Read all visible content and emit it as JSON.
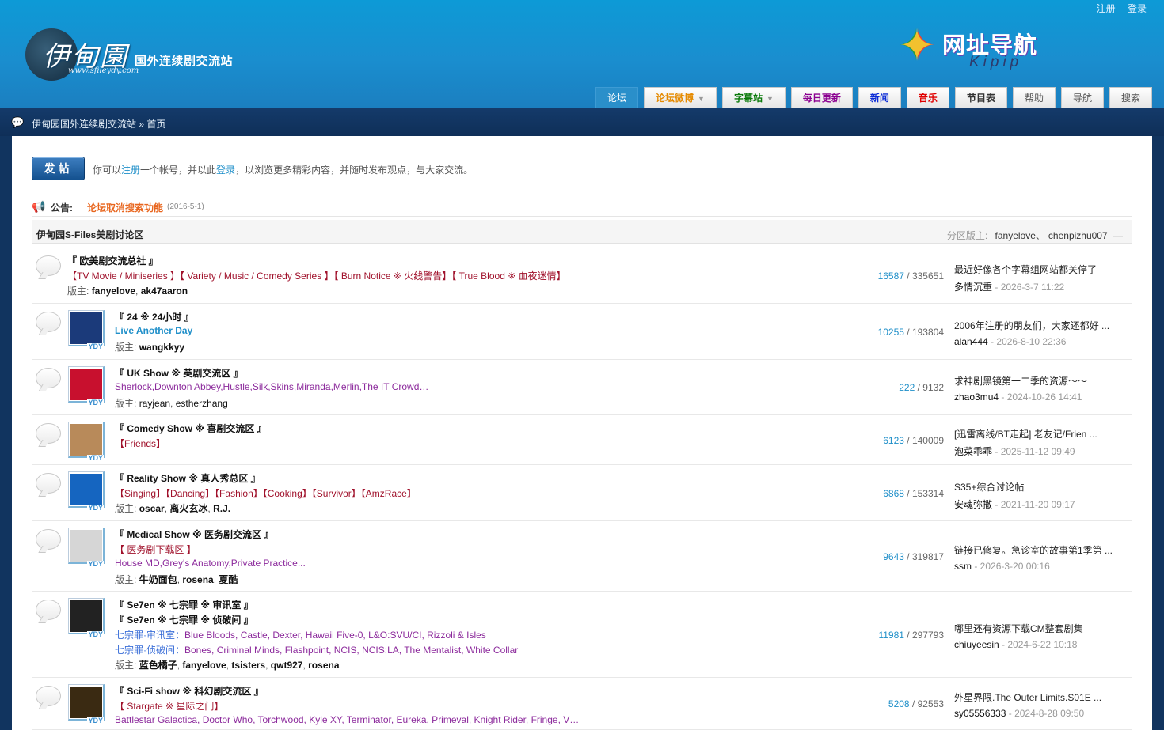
{
  "header": {
    "logo_cn": "伊甸園",
    "logo_url": "www.sfileydy.com",
    "logo_subtitle": "国外连续剧交流站",
    "top_links": [
      {
        "label": "注册"
      },
      {
        "label": "登录"
      }
    ],
    "kipip_cn": "网址导航",
    "kipip_en": "Kipip",
    "nav": [
      {
        "label": "论坛",
        "active": true,
        "color": "#ffffff",
        "bold": false,
        "dropdown": false
      },
      {
        "label": "论坛微博",
        "active": false,
        "color": "#e58a00",
        "bold": true,
        "dropdown": true
      },
      {
        "label": "字幕站",
        "active": false,
        "color": "#0a7a0a",
        "bold": true,
        "dropdown": true
      },
      {
        "label": "每日更新",
        "active": false,
        "color": "#8b0090",
        "bold": true,
        "dropdown": false
      },
      {
        "label": "新闻",
        "active": false,
        "color": "#0b2bd6",
        "bold": true,
        "dropdown": false
      },
      {
        "label": "音乐",
        "active": false,
        "color": "#e00000",
        "bold": true,
        "dropdown": false
      },
      {
        "label": "节目表",
        "active": false,
        "color": "#333333",
        "bold": true,
        "dropdown": false
      },
      {
        "label": "帮助",
        "active": false,
        "color": "#555555",
        "bold": false,
        "dropdown": false
      },
      {
        "label": "导航",
        "active": false,
        "color": "#555555",
        "bold": false,
        "dropdown": false
      },
      {
        "label": "搜索",
        "active": false,
        "color": "#555555",
        "bold": false,
        "dropdown": false
      }
    ]
  },
  "breadcrumb": {
    "site": "伊甸园国外连续剧交流站",
    "sep": "»",
    "current": "首页"
  },
  "post_button": "发帖",
  "welcome": {
    "pre": "你可以",
    "register": "注册",
    "mid": "一个帐号，并以此",
    "login": "登录",
    "post": "，以浏览更多精彩内容，并随时发布观点，与大家交流。"
  },
  "notice": {
    "label": "公告:",
    "text": "论坛取消搜索功能",
    "date": "(2016-5-1)"
  },
  "category": {
    "title": "伊甸园S-Files美剧讨论区",
    "mods_label": "分区版主:",
    "mods": [
      "fanyelove",
      "chenpizhu007"
    ],
    "mods_sep": "、",
    "dash": "—"
  },
  "forums": [
    {
      "name": "『 欧美剧交流总社 』",
      "lines": [
        [
          {
            "t": "【TV Movie / Miniseries 】【 Variety / Music / Comedy Series 】【 Burn Notice ※ 火线警告】【 True Blood ※ 血夜迷情】",
            "c": "r"
          }
        ]
      ],
      "mods_label": "版主:",
      "mods": [
        {
          "n": "fanyelove",
          "b": true
        },
        {
          "n": "ak47aaron",
          "b": true
        }
      ],
      "threads": "16587",
      "posts": "335651",
      "last_title": "最近好像各个字幕组网站都关停了",
      "last_author": "多情沉重",
      "last_date": "2026-3-7 11:22",
      "thumb": ""
    },
    {
      "name": "『 24 ※ 24小时 』",
      "lines": [
        [
          {
            "t": "Live Another Day",
            "c": "b"
          }
        ]
      ],
      "mods_label": "版主:",
      "mods": [
        {
          "n": "wangkkyy",
          "b": true
        }
      ],
      "threads": "10255",
      "posts": "193804",
      "last_title": "2006年注册的朋友们，大家还都好 ...",
      "last_author": "alan444",
      "last_date": "2026-8-10 22:36",
      "thumb": "24"
    },
    {
      "name": "『 UK Show ※ 英剧交流区 』",
      "lines": [
        [
          {
            "t": "Sherlock,Downton Abbey,Hustle,Silk,Skins,Miranda,Merlin,The IT Crowd…",
            "c": "p"
          }
        ]
      ],
      "mods_label": "版主:",
      "mods": [
        {
          "n": "rayjean",
          "b": false
        },
        {
          "n": "estherzhang",
          "b": false
        }
      ],
      "threads": "222",
      "posts": "9132",
      "last_title": "求神剧黑镜第一二季的资源～～",
      "last_author": "zhao3mu4",
      "last_date": "2024-10-26 14:41",
      "thumb": "UK"
    },
    {
      "name": "『 Comedy Show ※ 喜剧交流区 』",
      "lines": [
        [
          {
            "t": "【Friends】",
            "c": "r"
          }
        ]
      ],
      "mods_label": "",
      "mods": [],
      "threads": "6123",
      "posts": "140009",
      "last_title": "[迅雷离线/BT走起] 老友记/Frien ...",
      "last_author": "泡菜乖乖",
      "last_date": "2025-11-12 09:49",
      "thumb": "EARL"
    },
    {
      "name": "『 Reality Show ※ 真人秀总区 』",
      "lines": [
        [
          {
            "t": "【Singing】【Dancing】【Fashion】【Cooking】【Survivor】【AmzRace】",
            "c": "r"
          }
        ]
      ],
      "mods_label": "版主:",
      "mods": [
        {
          "n": "oscar",
          "b": true
        },
        {
          "n": "离火玄冰",
          "b": true
        },
        {
          "n": "R.J.",
          "b": true
        }
      ],
      "threads": "6868",
      "posts": "153314",
      "last_title": "S35+综合讨论帖",
      "last_author": "安魂弥撒",
      "last_date": "2021-11-20 09:17",
      "thumb": "Idol"
    },
    {
      "name": "『 Medical Show ※ 医务剧交流区 』",
      "lines": [
        [
          {
            "t": "【 医务剧下载区 】",
            "c": "r"
          }
        ],
        [
          {
            "t": "House MD,Grey's Anatomy,Private Practice...",
            "c": "p"
          }
        ]
      ],
      "mods_label": "版主:",
      "mods": [
        {
          "n": "牛奶面包",
          "b": true
        },
        {
          "n": "rosena",
          "b": true
        },
        {
          "n": "夏酷",
          "b": true
        }
      ],
      "threads": "9643",
      "posts": "319817",
      "last_title": "链接已修复。急诊室的故事第1季第 ...",
      "last_author": "ssm",
      "last_date": "2026-3-20 00:16",
      "thumb": "eye"
    },
    {
      "name": "『 Se7en ※ 七宗罪 ※ 审讯室 』",
      "name2": "『 Se7en ※ 七宗罪 ※ 侦破间 』",
      "lines": [
        [
          {
            "t": "七宗罪·审讯室：",
            "c": "bl"
          },
          {
            "t": "Blue Bloods, Castle, Dexter, Hawaii Five-0, L&O:SVU/CI, Rizzoli & Isles",
            "c": "p"
          }
        ],
        [
          {
            "t": "七宗罪·侦破间：",
            "c": "bl"
          },
          {
            "t": "Bones, Criminal Minds, Flashpoint, NCIS, NCIS:LA, The Mentalist, White Collar",
            "c": "p"
          }
        ]
      ],
      "mods_label": "版主:",
      "mods": [
        {
          "n": "蓝色橘子",
          "b": true
        },
        {
          "n": "fanyelove",
          "b": true
        },
        {
          "n": "tsisters",
          "b": true
        },
        {
          "n": "qwt927",
          "b": true
        },
        {
          "n": "rosena",
          "b": true
        }
      ],
      "threads": "11981",
      "posts": "297793",
      "last_title": "哪里还有资源下载CM整套剧集",
      "last_author": "chiuyeesin",
      "last_date": "2024-6-22 10:18",
      "thumb": "SE7EN"
    },
    {
      "name": "『 Sci-Fi show ※ 科幻剧交流区 』",
      "lines": [
        [
          {
            "t": "【 Stargate ※ 星际之门】",
            "c": "r"
          }
        ],
        [
          {
            "t": "Battlestar Galactica, Doctor Who, Torchwood, Kyle XY, Terminator, Eureka, Primeval, Knight Rider, Fringe, V…",
            "c": "p"
          }
        ]
      ],
      "mods_label": "",
      "mods": [],
      "threads": "5208",
      "posts": "92553",
      "last_title": "外星界限.The Outer Limits.S01E ...",
      "last_author": "sy05556333",
      "last_date": "2024-8-28 09:50",
      "thumb": "BSG"
    }
  ],
  "colors": {
    "header_blue": "#1a8ecf",
    "dark_blue": "#11345f",
    "link": "#1f8fc9",
    "red": "#a0112b",
    "purple": "#8c2a9c"
  },
  "icons": {
    "post": "post-button",
    "notice": "speaker-icon",
    "crumb": "chat-icon",
    "forum": "bubble-icon"
  }
}
